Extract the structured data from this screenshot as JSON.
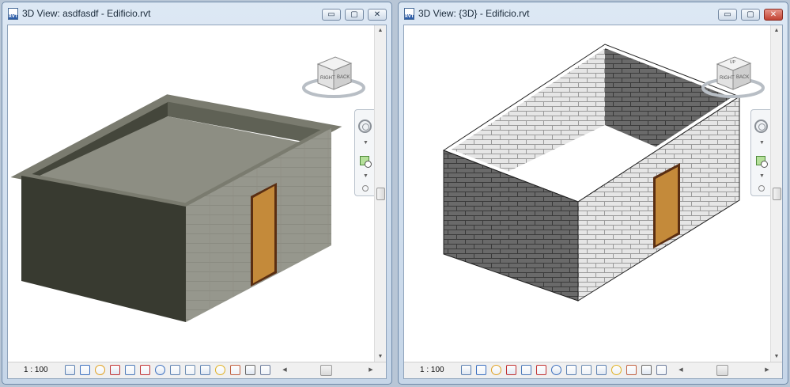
{
  "windows": [
    {
      "title": "3D View: asdfasdf - Edificio.rvt",
      "style": "shaded",
      "scale": "1 : 100",
      "close_active": false
    },
    {
      "title": "3D View: {3D} - Edificio.rvt",
      "style": "hidden-line",
      "scale": "1 : 100",
      "close_active": true
    }
  ],
  "window_buttons": {
    "minimize": "▭",
    "maximize": "▢",
    "close": "✕"
  },
  "app_icon_text": "RVT",
  "viewcube": {
    "right_face": "RIGHT",
    "back_face": "BACK",
    "top_face": "UP"
  },
  "view_control_icons": [
    "scale-icon",
    "detail-level-icon",
    "visual-style-icon",
    "sun-path-icon",
    "shadows-icon",
    "crop-view-icon",
    "show-crop-icon",
    "unlock-3d-view-icon",
    "temporary-hide-icon",
    "reveal-hidden-icon",
    "analysis-display-icon",
    "render-icon",
    "worksharing-icon",
    "hide-analytical-icon"
  ],
  "colors": {
    "shaded_dark_wall": "#383a30",
    "shaded_light_wall": "#96978d",
    "shaded_top": "#7a7b6f",
    "brick_dark": "#6a6a6a",
    "brick_light": "#e6e6e6",
    "door": "#c48a3a",
    "door_frame": "#5a2e12"
  }
}
